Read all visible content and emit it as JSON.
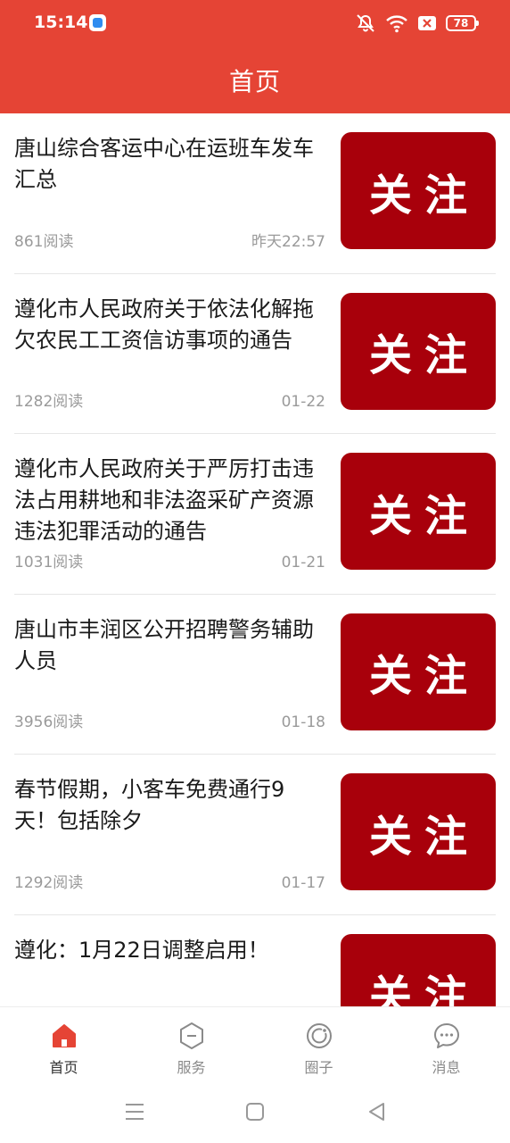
{
  "status": {
    "time": "15:14",
    "battery": "78"
  },
  "header": {
    "title": "首页"
  },
  "news": [
    {
      "title": "唐山综合客运中心在运班车发车汇总",
      "reads": "861阅读",
      "date": "昨天22:57",
      "thumb_label": "关注"
    },
    {
      "title": "遵化市人民政府关于依法化解拖欠农民工工资信访事项的通告",
      "reads": "1282阅读",
      "date": "01-22",
      "thumb_label": "关注"
    },
    {
      "title": "遵化市人民政府关于严厉打击违法占用耕地和非法盗采矿产资源违法犯罪活动的通告",
      "reads": "1031阅读",
      "date": "01-21",
      "thumb_label": "关注"
    },
    {
      "title": "唐山市丰润区公开招聘警务辅助人员",
      "reads": "3956阅读",
      "date": "01-18",
      "thumb_label": "关注"
    },
    {
      "title": "春节假期，小客车免费通行9天！包括除夕",
      "reads": "1292阅读",
      "date": "01-17",
      "thumb_label": "关注"
    },
    {
      "title": "遵化：1月22日调整启用！",
      "reads": "",
      "date": "",
      "thumb_label": "关注"
    }
  ],
  "tabs": [
    {
      "label": "首页",
      "icon": "home-icon",
      "active": true
    },
    {
      "label": "服务",
      "icon": "service-icon",
      "active": false
    },
    {
      "label": "圈子",
      "icon": "circle-icon",
      "active": false
    },
    {
      "label": "消息",
      "icon": "message-icon",
      "active": false
    }
  ],
  "colors": {
    "brand": "#e54435",
    "thumb": "#a8000b",
    "active_tab": "#e54435",
    "muted": "#9a9a9a"
  }
}
